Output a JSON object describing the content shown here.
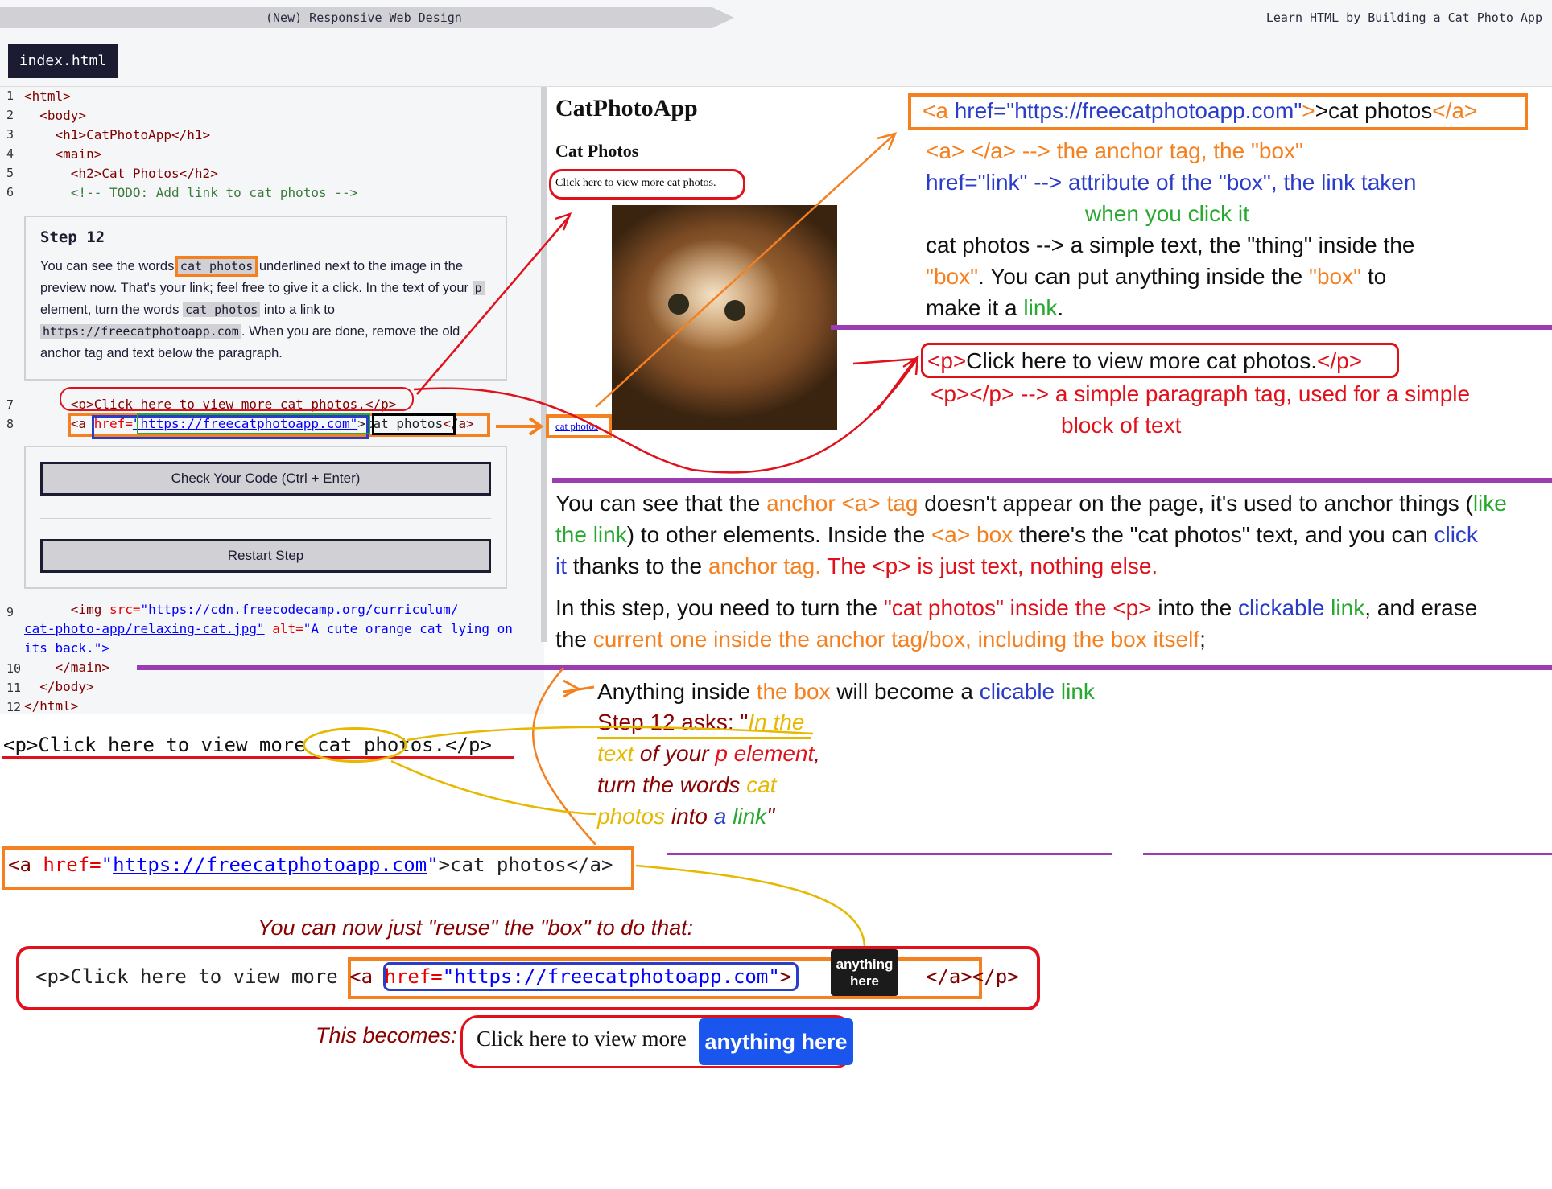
{
  "header": {
    "course": "(New) Responsive Web Design",
    "lesson": "Learn HTML by Building a Cat Photo App"
  },
  "tab": {
    "label": "index.html"
  },
  "lines": {
    "n1": "1",
    "n2": "2",
    "n3": "3",
    "n4": "4",
    "n5": "5",
    "n6": "6",
    "n7": "7",
    "n8": "8",
    "n9": "9",
    "n10": "10",
    "n11": "11",
    "n12": "12",
    "l1": "<html>",
    "l2": "  <body>",
    "l3": "    <h1>CatPhotoApp</h1>",
    "l4": "    <main>",
    "l5": "      <h2>Cat Photos</h2>",
    "l6": "      <!-- TODO: Add link to cat photos -->",
    "l7": "      <p>Click here to view more cat photos.</p>",
    "l8a": "      <a ",
    "l8b": "href=",
    "l8c": "\"https://freecatphotoapp.com\"",
    "l8d": ">cat photos",
    "l8e": "</a>",
    "l9a": "      <img ",
    "l9b": "src=",
    "l9c": "\"https://cdn.freecodecamp.org/curriculum/",
    "l9d": "cat-photo-app/relaxing-cat.jpg\"",
    "l9e": " alt=",
    "l9f": "\"A cute orange cat lying on",
    "l9g": "its back.\">",
    "l10": "    </main>",
    "l11": "  </body>",
    "l12": "</html>"
  },
  "step": {
    "title": "Step 12",
    "d1": "You can see the words ",
    "c1": "cat photos",
    "d2": " underlined next to the image in the preview now. That's your link; feel free to give it a click. In the text of your ",
    "c2": "p",
    "d3": " element, turn the words ",
    "c3": "cat photos",
    "d4": " into a link to ",
    "c4": "https://freecatphotoapp.com",
    "d5": ". When you are done, remove the old anchor tag and text below the paragraph."
  },
  "buttons": {
    "check": "Check Your Code (Ctrl + Enter)",
    "restart": "Restart Step"
  },
  "preview": {
    "h1": "CatPhotoApp",
    "h2": "Cat Photos",
    "p": "Click here to view more cat photos.",
    "link": "cat photos"
  },
  "notes": {
    "anchor_code_a": "<a ",
    "anchor_code_b": "href=\"https://freecatphotoapp.com\"",
    "anchor_code_c": ">cat photos",
    "anchor_code_d": "</a>",
    "n1a": "<a> </a> --> the anchor tag, the \"box\"",
    "n2a": "href=\"link\" --> attribute of the \"box\", the link taken",
    "n2b": "when you click it",
    "n3a": "cat photos --> a simple text, the \"thing\" inside the",
    "n3b": "\"box\"",
    "n3c": ". You can put anything inside the ",
    "n3d": "\"box\"",
    "n3e": " to",
    "n3f": "make it a ",
    "n3g": "link",
    ".": ".",
    "p_code_a": "<p>",
    "p_code_b": "Click here to view more cat photos.",
    "p_code_c": "</p>",
    "p1": "<p></p> --> a simple paragraph tag, used for a simple",
    "p2": "block of text",
    "m1a": "You can see that the ",
    "m1b": "anchor <a> tag",
    "m1c": " doesn't appear on the page, it's used to anchor things (",
    "m1d": "like",
    "m2a": "the link",
    "m2b": ") to other elements. Inside the ",
    "m2c": "<a> box",
    "m2d": " there's the \"cat photos\" text, and you can ",
    "m2e": "click",
    "m3a": "it",
    "m3b": " thanks to the ",
    "m3c": "anchor tag.",
    "m3d": " The <p> is just text, nothing else.",
    "m4a": "In this step, you need to turn the ",
    "m4b": "\"cat photos\" inside the <p>",
    "m4c": " into the ",
    "m4d": "clickable",
    "m4e": " link",
    "m4f": ", and erase",
    "m5a": "the ",
    "m5b": "current one inside the anchor tag/box, including the box itself",
    "m5c": ";",
    "a1a": "Anything inside ",
    "a1b": "the box",
    "a1c": " will become a ",
    "a1d": "clicable",
    "a1e": " link",
    "a2a": "Step 12 asks: \"",
    "a2b": "In the",
    "a3a": "text",
    "a3b": " of your ",
    "a3c": "p element",
    ",": ",",
    "a4a": "turn the words ",
    "a4b": "cat",
    "a5a": "photos",
    "a5b": " into ",
    "a5c": "a",
    "a5d": " link",
    "a5e": "\"",
    "bp_a": "<p>Click here to view more ",
    "bp_b": "cat photos",
    "bp_c": ".</p>",
    "ba_a": "<a ",
    "ba_b": "href=",
    "ba_c": "\"",
    "ba_d": "https://freecatphotoapp.com",
    "ba_e": "\"",
    ">": ">",
    "ba_f": "cat photos</a>",
    "reuse": "You can now just \"reuse\" the \"box\" to do that:",
    "r_a": "<p>Click here to view more ",
    "r_b": "<a ",
    "r_c": "href=",
    "r_d": "\"https://freecatphotoapp.com\"",
    "r_e": ">",
    "r_f": "anything here",
    "r_g": "</a>",
    "r_h": "</p>",
    "becomes": "This becomes:",
    "res_text": "Click here to view more ",
    "res_link": "anything here"
  }
}
